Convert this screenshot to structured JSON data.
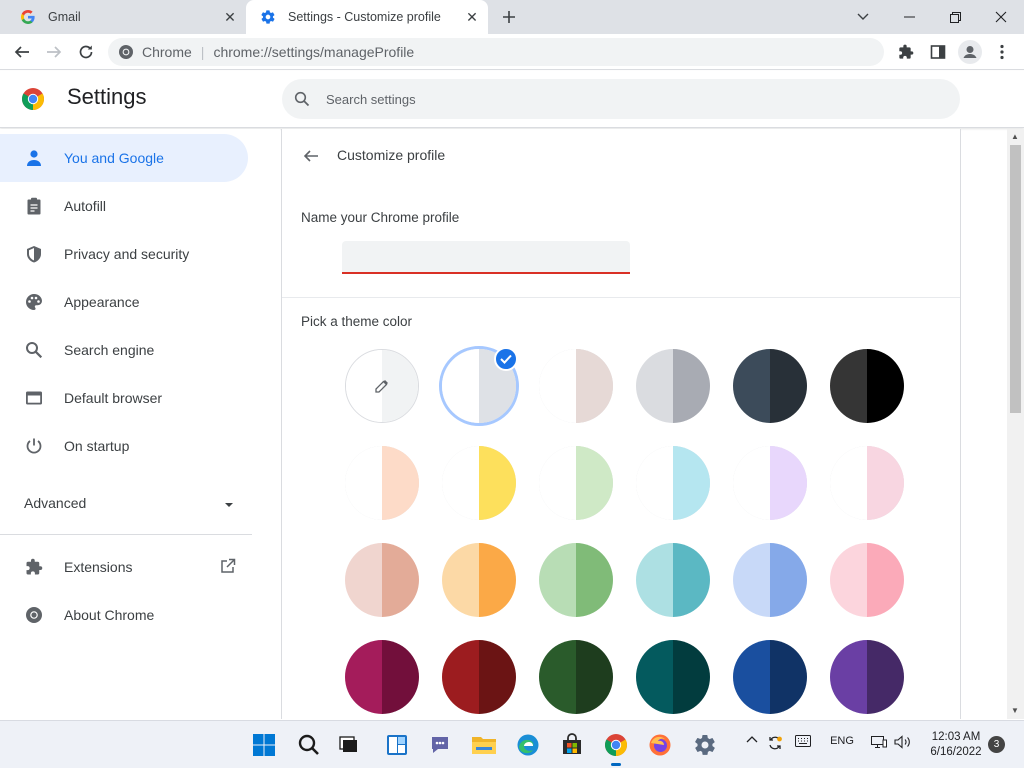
{
  "tabs": [
    {
      "title": "Gmail",
      "favicon": "google-g-icon",
      "active": false
    },
    {
      "title": "Settings - Customize profile",
      "favicon": "settings-gear-icon",
      "active": true
    }
  ],
  "omnibox": {
    "site": "Chrome",
    "url": "chrome://settings/manageProfile"
  },
  "header": {
    "title": "Settings",
    "search_placeholder": "Search settings"
  },
  "sidebar": {
    "items": [
      {
        "label": "You and Google",
        "icon": "person-icon",
        "selected": true
      },
      {
        "label": "Autofill",
        "icon": "clipboard-icon"
      },
      {
        "label": "Privacy and security",
        "icon": "shield-icon"
      },
      {
        "label": "Appearance",
        "icon": "palette-icon"
      },
      {
        "label": "Search engine",
        "icon": "search-icon"
      },
      {
        "label": "Default browser",
        "icon": "browser-icon"
      },
      {
        "label": "On startup",
        "icon": "power-icon"
      }
    ],
    "advanced": "Advanced",
    "extensions": "Extensions",
    "about": "About Chrome"
  },
  "main": {
    "subpage_title": "Customize profile",
    "name_label": "Name your Chrome profile",
    "name_value": "",
    "theme_label": "Pick a theme color",
    "selected_theme_index": 1,
    "themes": [
      {
        "left": "#ffffff",
        "right": "#f1f3f4",
        "custom": true
      },
      {
        "left": "#ffffff",
        "right": "#dee1e6"
      },
      {
        "left": "#ffffff",
        "right": "#e6d9d6"
      },
      {
        "left": "#dadce0",
        "right": "#a8abb3"
      },
      {
        "left": "#3c4b5a",
        "right": "#283038"
      },
      {
        "left": "#353535",
        "right": "#000000"
      },
      {
        "left": "#ffffff",
        "right": "#fddbc8"
      },
      {
        "left": "#ffffff",
        "right": "#fde05c"
      },
      {
        "left": "#ffffff",
        "right": "#cfe9c6"
      },
      {
        "left": "#ffffff",
        "right": "#b5e6f0"
      },
      {
        "left": "#ffffff",
        "right": "#e8d7fc"
      },
      {
        "left": "#ffffff",
        "right": "#f8d6e1"
      },
      {
        "left": "#f0d5cf",
        "right": "#e3ab98"
      },
      {
        "left": "#fcd9a6",
        "right": "#fba947"
      },
      {
        "left": "#b8ddb5",
        "right": "#80bb78"
      },
      {
        "left": "#ade0e3",
        "right": "#5bb8c3"
      },
      {
        "left": "#c8d9f8",
        "right": "#85a9e9"
      },
      {
        "left": "#fcd5dd",
        "right": "#fbaab9"
      },
      {
        "left": "#a41c5b",
        "right": "#720f3b"
      },
      {
        "left": "#9c1c1f",
        "right": "#6b1414"
      },
      {
        "left": "#2a5b2b",
        "right": "#1e3d1e"
      },
      {
        "left": "#045a5e",
        "right": "#023c3e"
      },
      {
        "left": "#1a4f9f",
        "right": "#103366"
      },
      {
        "left": "#6a3fa4",
        "right": "#452967"
      }
    ]
  },
  "taskbar": {
    "apps": [
      "windows-start-icon",
      "search-icon",
      "task-view-icon",
      "widgets-icon",
      "teams-chat-icon",
      "file-explorer-icon",
      "edge-icon",
      "store-icon",
      "chrome-icon",
      "firefox-icon",
      "settings-icon"
    ],
    "language": "ENG",
    "time": "12:03 AM",
    "date": "6/16/2022",
    "notifications": "3"
  },
  "colors": {
    "accent": "#1a73e8",
    "selected_nav_bg": "#e8f0fe",
    "error_underline": "#d93025"
  }
}
